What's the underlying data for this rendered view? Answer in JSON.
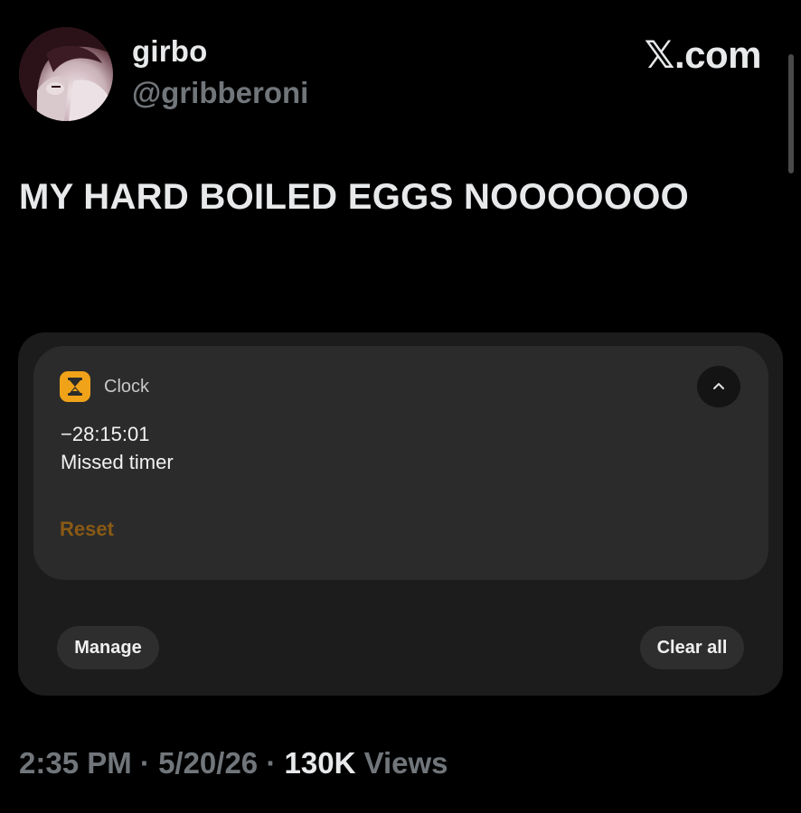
{
  "author": {
    "display_name": "girbo",
    "handle": "@gribberoni"
  },
  "site_brand": "𝕏.com",
  "tweet": {
    "text": "MY HARD BOILED EGGS NOOOOOOO"
  },
  "notification": {
    "app_name": "Clock",
    "app_icon": "hourglass-icon",
    "timer_value": "−28:15:01",
    "timer_status": "Missed timer",
    "action_label": "Reset",
    "manage_label": "Manage",
    "clear_all_label": "Clear all",
    "accent_color": "#f0a319"
  },
  "meta": {
    "time": "2:35 PM",
    "separator": "·",
    "date": "5/20/26",
    "views_count": "130K",
    "views_label": "Views"
  }
}
